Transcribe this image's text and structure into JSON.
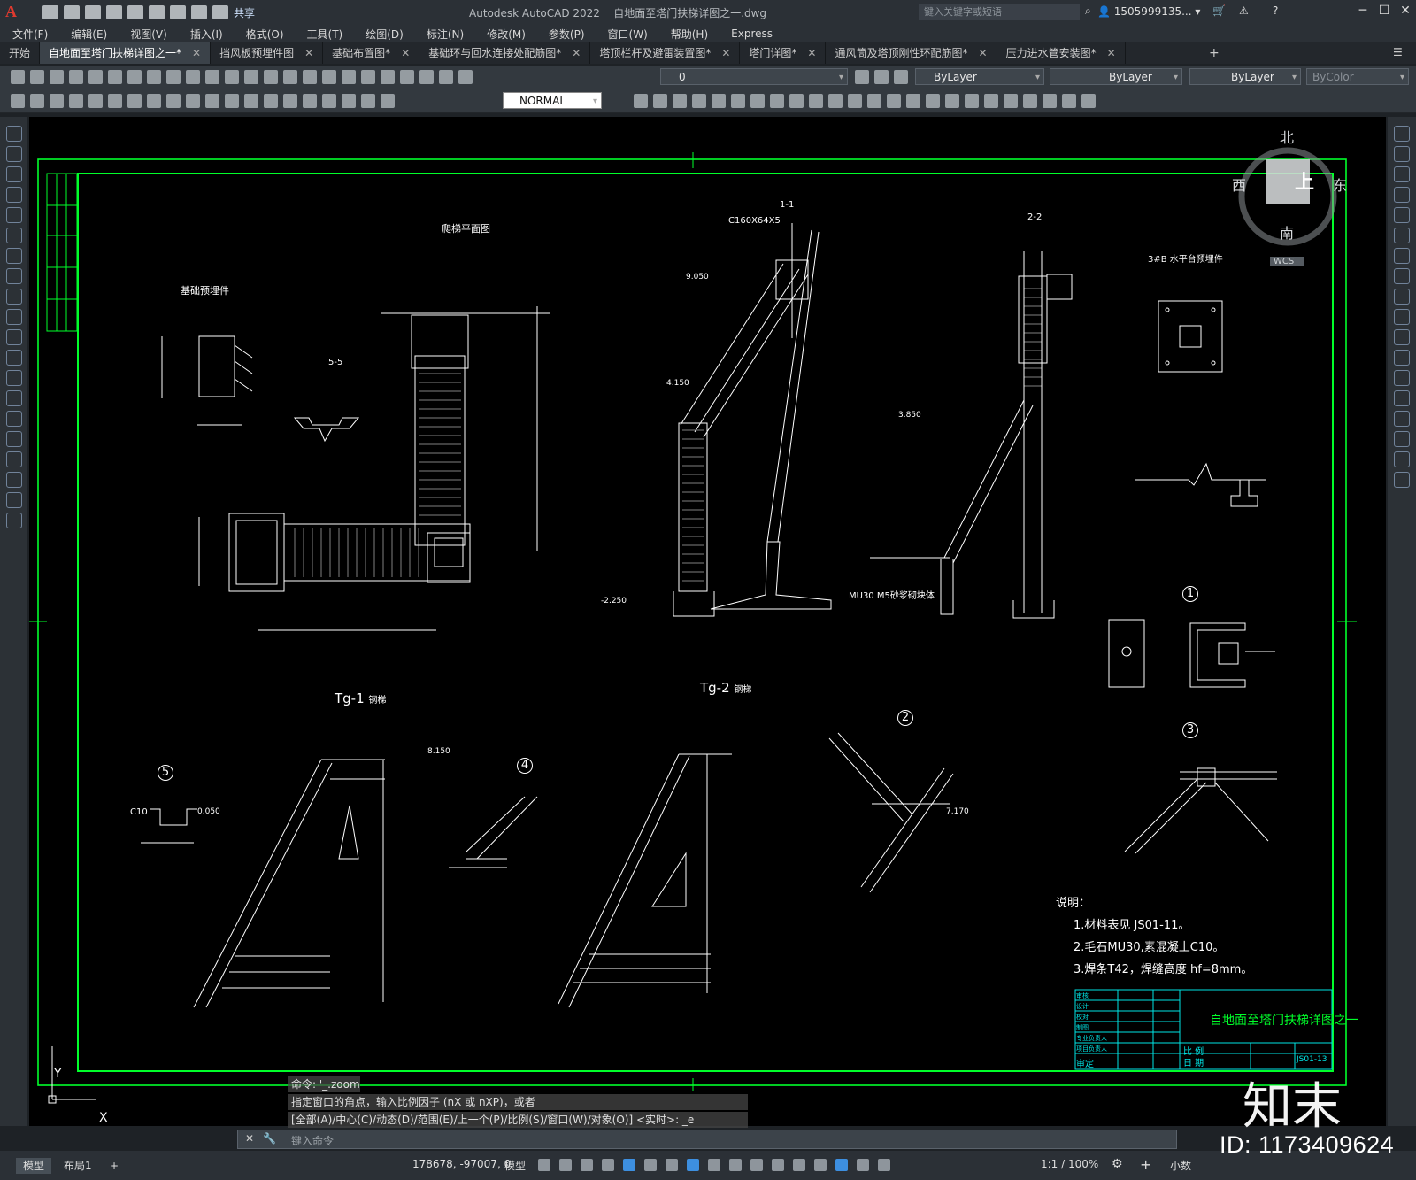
{
  "window": {
    "app_title": "Autodesk AutoCAD 2022",
    "file_title": "自地面至塔门扶梯详图之一.dwg",
    "share_label": "共享",
    "search_placeholder": "键入关键字或短语",
    "user": "1505999135...",
    "minimize": "─",
    "restore": "☐",
    "close": "✕"
  },
  "menu": [
    "文件(F)",
    "编辑(E)",
    "视图(V)",
    "插入(I)",
    "格式(O)",
    "工具(T)",
    "绘图(D)",
    "标注(N)",
    "修改(M)",
    "参数(P)",
    "窗口(W)",
    "帮助(H)",
    "Express"
  ],
  "tabs": [
    {
      "label": "开始",
      "active": false,
      "closable": false
    },
    {
      "label": "自地面至塔门扶梯详图之一*",
      "active": true,
      "closable": true
    },
    {
      "label": "挡风板预埋件图",
      "active": false,
      "closable": true
    },
    {
      "label": "基础布置图*",
      "active": false,
      "closable": true
    },
    {
      "label": "基础环与回水连接处配筋图*",
      "active": false,
      "closable": true
    },
    {
      "label": "塔顶栏杆及避雷装置图*",
      "active": false,
      "closable": true
    },
    {
      "label": "塔门详图*",
      "active": false,
      "closable": true
    },
    {
      "label": "通风筒及塔顶刚性环配筋图*",
      "active": false,
      "closable": true
    },
    {
      "label": "压力进水管安装图*",
      "active": false,
      "closable": true
    }
  ],
  "toolbar": {
    "layer_value": "0",
    "color_value": "ByLayer",
    "linetype_value": "ByLayer",
    "lineweight_value": "ByLayer",
    "plotstyle_value": "ByColor",
    "dimstyle_value": "NORMAL"
  },
  "viewcube": {
    "north": "北",
    "south": "南",
    "east": "东",
    "west": "西",
    "face": "上",
    "wcs": "WCS"
  },
  "drawing": {
    "title_block_title": "自地面至塔门扶梯详图之一",
    "title_block_rows": [
      "审核",
      "设计",
      "校对",
      "制图",
      "专业负责人",
      "项目负责人",
      "审定"
    ],
    "title_block_ratio": "比 例",
    "title_block_date": "日 期",
    "title_block_no": "JS01-13",
    "notes_title": "说明：",
    "notes": [
      "1.材料表见 JS01-11。",
      "2.毛石MU30,素混凝土C10。",
      "3.焊条T42，焊缝高度 hf=8mm。"
    ],
    "labels": {
      "foundation_embed": "基础预埋件",
      "ladder_plan": "爬梯平面图",
      "tg1": "Tg-1",
      "tg1_suffix": "钢梯",
      "tg2": "Tg-2",
      "tg2_suffix": "钢梯",
      "platform_embed": "3#B 水平台预埋件",
      "sec_1_1": "1-1",
      "sec_2_2": "2-2",
      "sec_5_5": "5-5",
      "channel": "C160X64X5",
      "mu30": "MU30 M5砂浆砌块体",
      "c10_m": "C10",
      "elev_0050": "0.050",
      "elev_8150": "8.150",
      "elev_3850": "3.850",
      "elev_n2250": "-2.250",
      "elev_4150": "4.150",
      "elev_9050": "9.050",
      "elev_7170": "7.170"
    },
    "detail_marks": [
      "1",
      "2",
      "3",
      "4",
      "5"
    ]
  },
  "command": {
    "history": [
      "命令: '_.zoom",
      "指定窗口的角点，输入比例因子 (nX 或 nXP)，或者",
      "[全部(A)/中心(C)/动态(D)/范围(E)/上一个(P)/比例(S)/窗口(W)/对象(O)] <实时>: _e"
    ],
    "placeholder": "键入命令"
  },
  "status": {
    "layout_tabs": [
      "模型",
      "布局1"
    ],
    "add_tab": "+",
    "coordinates": "178678, -97007, 0",
    "space": "模型",
    "scale": "1:1 / 100%",
    "units": "小数"
  },
  "watermark": {
    "brand": "知末",
    "id": "ID: 1173409624"
  },
  "colors": {
    "drawing_green": "#00ff2a",
    "drawing_white": "#ffffff",
    "title_cyan": "#00e5e5",
    "canvas_bg": "#000000",
    "accent_blue": "#3d8fe0"
  }
}
